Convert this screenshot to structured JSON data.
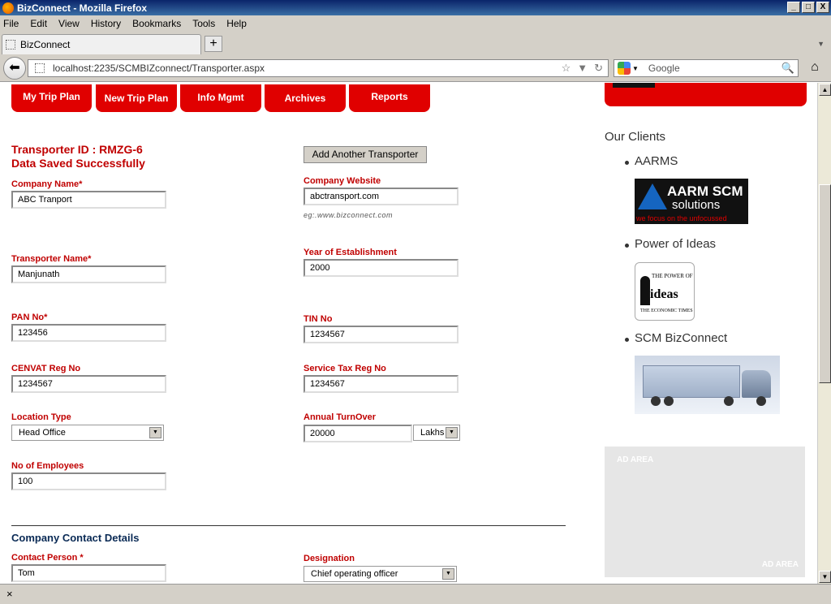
{
  "window": {
    "title": "BizConnect - Mozilla Firefox",
    "min": "_",
    "max": "□",
    "close": "X"
  },
  "menu": [
    "File",
    "Edit",
    "View",
    "History",
    "Bookmarks",
    "Tools",
    "Help"
  ],
  "tab": {
    "label": "BizConnect",
    "newtab": "+",
    "dropdown": "▼"
  },
  "nav": {
    "url": "localhost:2235/SCMBIZconnect/Transporter.aspx",
    "search_placeholder": "Google"
  },
  "site_tabs": [
    "My Trip Plan",
    "New Trip Plan",
    "Info Mgmt",
    "Archives",
    "Reports"
  ],
  "status": {
    "transporter_id": "Transporter ID :  RMZG-6",
    "message": "Data Saved Successfully"
  },
  "add_button": "Add Another Transporter",
  "form": {
    "company_name": {
      "label": "Company Name*",
      "value": "ABC Tranport"
    },
    "company_website": {
      "label": "Company Website",
      "value": "abctransport.com",
      "hint": "eg:.www.bizconnect.com"
    },
    "transporter_name": {
      "label": "Transporter Name*",
      "value": "Manjunath"
    },
    "year_established": {
      "label": "Year of Establishment",
      "value": "2000"
    },
    "pan_no": {
      "label": "PAN No*",
      "value": "123456"
    },
    "tin_no": {
      "label": "TIN No",
      "value": "1234567"
    },
    "cenvat": {
      "label": "CENVAT Reg No",
      "value": "1234567"
    },
    "service_tax": {
      "label": "Service Tax Reg No",
      "value": "1234567"
    },
    "location_type": {
      "label": "Location Type",
      "value": "Head Office"
    },
    "annual_turnover": {
      "label": "Annual TurnOver",
      "value": "20000",
      "unit": "Lakhs"
    },
    "employees": {
      "label": "No of Employees",
      "value": "100"
    }
  },
  "contact": {
    "section_title": "Company Contact Details",
    "person": {
      "label": "Contact Person *",
      "value": "Tom"
    },
    "designation": {
      "label": "Designation",
      "value": "Chief operating officer"
    }
  },
  "clients": {
    "title": "Our Clients",
    "items": [
      {
        "name": "AARMS",
        "logo_text": "AARM SCM",
        "logo_sub": "solutions",
        "logo_tag": "we focus on the unfocussed"
      },
      {
        "name": "Power of Ideas",
        "logo_text": "THE POWER OF",
        "logo_big": "ideas",
        "logo_foot": "THE ECONOMIC TIMES"
      },
      {
        "name": "SCM BizConnect"
      }
    ]
  },
  "ad": {
    "top": "AD AREA",
    "bottom": "AD AREA"
  },
  "statusbar": {
    "close": "×"
  }
}
